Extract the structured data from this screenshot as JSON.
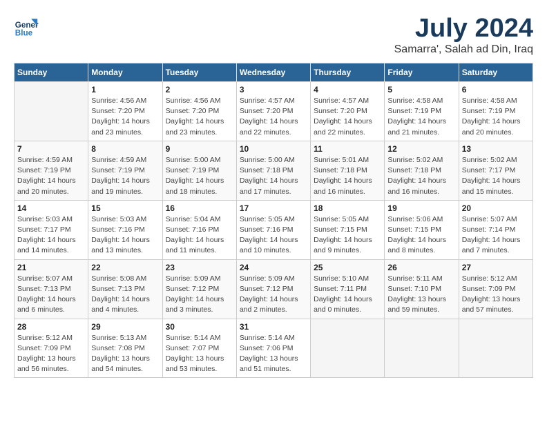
{
  "logo": {
    "line1": "General",
    "line2": "Blue"
  },
  "title": "July 2024",
  "subtitle": "Samarra', Salah ad Din, Iraq",
  "days_of_week": [
    "Sunday",
    "Monday",
    "Tuesday",
    "Wednesday",
    "Thursday",
    "Friday",
    "Saturday"
  ],
  "weeks": [
    [
      {
        "day": null,
        "info": null
      },
      {
        "day": "1",
        "info": "Sunrise: 4:56 AM\nSunset: 7:20 PM\nDaylight: 14 hours\nand 23 minutes."
      },
      {
        "day": "2",
        "info": "Sunrise: 4:56 AM\nSunset: 7:20 PM\nDaylight: 14 hours\nand 23 minutes."
      },
      {
        "day": "3",
        "info": "Sunrise: 4:57 AM\nSunset: 7:20 PM\nDaylight: 14 hours\nand 22 minutes."
      },
      {
        "day": "4",
        "info": "Sunrise: 4:57 AM\nSunset: 7:20 PM\nDaylight: 14 hours\nand 22 minutes."
      },
      {
        "day": "5",
        "info": "Sunrise: 4:58 AM\nSunset: 7:19 PM\nDaylight: 14 hours\nand 21 minutes."
      },
      {
        "day": "6",
        "info": "Sunrise: 4:58 AM\nSunset: 7:19 PM\nDaylight: 14 hours\nand 20 minutes."
      }
    ],
    [
      {
        "day": "7",
        "info": "Sunrise: 4:59 AM\nSunset: 7:19 PM\nDaylight: 14 hours\nand 20 minutes."
      },
      {
        "day": "8",
        "info": "Sunrise: 4:59 AM\nSunset: 7:19 PM\nDaylight: 14 hours\nand 19 minutes."
      },
      {
        "day": "9",
        "info": "Sunrise: 5:00 AM\nSunset: 7:19 PM\nDaylight: 14 hours\nand 18 minutes."
      },
      {
        "day": "10",
        "info": "Sunrise: 5:00 AM\nSunset: 7:18 PM\nDaylight: 14 hours\nand 17 minutes."
      },
      {
        "day": "11",
        "info": "Sunrise: 5:01 AM\nSunset: 7:18 PM\nDaylight: 14 hours\nand 16 minutes."
      },
      {
        "day": "12",
        "info": "Sunrise: 5:02 AM\nSunset: 7:18 PM\nDaylight: 14 hours\nand 16 minutes."
      },
      {
        "day": "13",
        "info": "Sunrise: 5:02 AM\nSunset: 7:17 PM\nDaylight: 14 hours\nand 15 minutes."
      }
    ],
    [
      {
        "day": "14",
        "info": "Sunrise: 5:03 AM\nSunset: 7:17 PM\nDaylight: 14 hours\nand 14 minutes."
      },
      {
        "day": "15",
        "info": "Sunrise: 5:03 AM\nSunset: 7:16 PM\nDaylight: 14 hours\nand 13 minutes."
      },
      {
        "day": "16",
        "info": "Sunrise: 5:04 AM\nSunset: 7:16 PM\nDaylight: 14 hours\nand 11 minutes."
      },
      {
        "day": "17",
        "info": "Sunrise: 5:05 AM\nSunset: 7:16 PM\nDaylight: 14 hours\nand 10 minutes."
      },
      {
        "day": "18",
        "info": "Sunrise: 5:05 AM\nSunset: 7:15 PM\nDaylight: 14 hours\nand 9 minutes."
      },
      {
        "day": "19",
        "info": "Sunrise: 5:06 AM\nSunset: 7:15 PM\nDaylight: 14 hours\nand 8 minutes."
      },
      {
        "day": "20",
        "info": "Sunrise: 5:07 AM\nSunset: 7:14 PM\nDaylight: 14 hours\nand 7 minutes."
      }
    ],
    [
      {
        "day": "21",
        "info": "Sunrise: 5:07 AM\nSunset: 7:13 PM\nDaylight: 14 hours\nand 6 minutes."
      },
      {
        "day": "22",
        "info": "Sunrise: 5:08 AM\nSunset: 7:13 PM\nDaylight: 14 hours\nand 4 minutes."
      },
      {
        "day": "23",
        "info": "Sunrise: 5:09 AM\nSunset: 7:12 PM\nDaylight: 14 hours\nand 3 minutes."
      },
      {
        "day": "24",
        "info": "Sunrise: 5:09 AM\nSunset: 7:12 PM\nDaylight: 14 hours\nand 2 minutes."
      },
      {
        "day": "25",
        "info": "Sunrise: 5:10 AM\nSunset: 7:11 PM\nDaylight: 14 hours\nand 0 minutes."
      },
      {
        "day": "26",
        "info": "Sunrise: 5:11 AM\nSunset: 7:10 PM\nDaylight: 13 hours\nand 59 minutes."
      },
      {
        "day": "27",
        "info": "Sunrise: 5:12 AM\nSunset: 7:09 PM\nDaylight: 13 hours\nand 57 minutes."
      }
    ],
    [
      {
        "day": "28",
        "info": "Sunrise: 5:12 AM\nSunset: 7:09 PM\nDaylight: 13 hours\nand 56 minutes."
      },
      {
        "day": "29",
        "info": "Sunrise: 5:13 AM\nSunset: 7:08 PM\nDaylight: 13 hours\nand 54 minutes."
      },
      {
        "day": "30",
        "info": "Sunrise: 5:14 AM\nSunset: 7:07 PM\nDaylight: 13 hours\nand 53 minutes."
      },
      {
        "day": "31",
        "info": "Sunrise: 5:14 AM\nSunset: 7:06 PM\nDaylight: 13 hours\nand 51 minutes."
      },
      {
        "day": null,
        "info": null
      },
      {
        "day": null,
        "info": null
      },
      {
        "day": null,
        "info": null
      }
    ]
  ]
}
